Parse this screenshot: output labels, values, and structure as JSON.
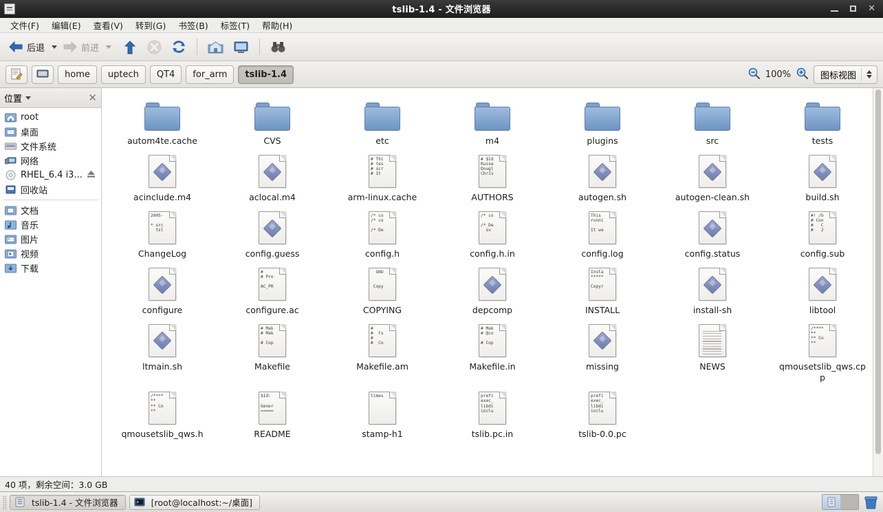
{
  "window": {
    "title": "tslib-1.4 - 文件浏览器",
    "icon": "file-manager-icon",
    "minimize_label": "最小化",
    "maximize_label": "最大化",
    "close_label": "关闭"
  },
  "menubar": [
    {
      "label": "文件(F)",
      "name": "menu-file"
    },
    {
      "label": "编辑(E)",
      "name": "menu-edit"
    },
    {
      "label": "查看(V)",
      "name": "menu-view"
    },
    {
      "label": "转到(G)",
      "name": "menu-go"
    },
    {
      "label": "书签(B)",
      "name": "menu-bookmarks"
    },
    {
      "label": "标签(T)",
      "name": "menu-tabs"
    },
    {
      "label": "帮助(H)",
      "name": "menu-help"
    }
  ],
  "toolbar": {
    "back_label": "后退",
    "forward_label": "前进",
    "up_label": "向上",
    "stop_label": "停止",
    "reload_label": "重新载入",
    "home_label": "主文件夹",
    "computer_label": "计算机",
    "search_label": "搜索"
  },
  "pathbar": {
    "edit_location_label": "编辑位置",
    "crumbs": [
      {
        "label": "",
        "icon": "computer-icon",
        "active": false
      },
      {
        "label": "home",
        "active": false
      },
      {
        "label": "uptech",
        "active": false
      },
      {
        "label": "QT4",
        "active": false
      },
      {
        "label": "for_arm",
        "active": false
      },
      {
        "label": "tslib-1.4",
        "active": true
      }
    ],
    "zoom_out_label": "缩小",
    "zoom_level": "100%",
    "zoom_in_label": "放大",
    "view_mode": "图标视图"
  },
  "sidebar": {
    "header": "位置",
    "close_label": "关闭侧边栏",
    "groups": [
      [
        {
          "label": "root",
          "icon": "home-folder-icon"
        },
        {
          "label": "桌面",
          "icon": "desktop-folder-icon"
        },
        {
          "label": "文件系统",
          "icon": "drive-icon"
        },
        {
          "label": "网络",
          "icon": "network-icon"
        },
        {
          "label": "RHEL_6.4 i3...",
          "icon": "optical-disc-icon",
          "eject": true
        },
        {
          "label": "回收站",
          "icon": "trash-icon"
        }
      ],
      [
        {
          "label": "文档",
          "icon": "documents-folder-icon"
        },
        {
          "label": "音乐",
          "icon": "music-folder-icon"
        },
        {
          "label": "图片",
          "icon": "pictures-folder-icon"
        },
        {
          "label": "视频",
          "icon": "videos-folder-icon"
        },
        {
          "label": "下载",
          "icon": "downloads-folder-icon"
        }
      ]
    ]
  },
  "files": [
    {
      "name": "autom4te.cache",
      "type": "folder"
    },
    {
      "name": "CVS",
      "type": "folder"
    },
    {
      "name": "etc",
      "type": "folder"
    },
    {
      "name": "m4",
      "type": "folder"
    },
    {
      "name": "plugins",
      "type": "folder"
    },
    {
      "name": "src",
      "type": "folder"
    },
    {
      "name": "tests",
      "type": "folder"
    },
    {
      "name": "acinclude.m4",
      "type": "script"
    },
    {
      "name": "aclocal.m4",
      "type": "script"
    },
    {
      "name": "arm-linux.cache",
      "type": "text",
      "preview": "# Thi\n# tes\n# scr\n# It"
    },
    {
      "name": "AUTHORS",
      "type": "text",
      "preview": "# $Id\nRusse\nDougl\nChris"
    },
    {
      "name": "autogen.sh",
      "type": "script"
    },
    {
      "name": "autogen-clean.sh",
      "type": "script"
    },
    {
      "name": "build.sh",
      "type": "script"
    },
    {
      "name": "ChangeLog",
      "type": "text",
      "preview": "2005-\n\n* src\n  tsl"
    },
    {
      "name": "config.guess",
      "type": "script"
    },
    {
      "name": "config.h",
      "type": "text",
      "preview": "/* co\n/* co\n\n/* De"
    },
    {
      "name": "config.h.in",
      "type": "text",
      "preview": "/* co\n\n/* De\n  sv"
    },
    {
      "name": "config.log",
      "type": "text",
      "preview": "This\nrunni\n\nIt wa"
    },
    {
      "name": "config.status",
      "type": "script"
    },
    {
      "name": "config.sub",
      "type": "text",
      "preview": "#! /b\n# Con\n#   C\n#   2"
    },
    {
      "name": "configure",
      "type": "script"
    },
    {
      "name": "configure.ac",
      "type": "text",
      "preview": "#\n# Pro\n\nAC_PR"
    },
    {
      "name": "COPYING",
      "type": "text",
      "preview": "  GNU\n\n\n Copy"
    },
    {
      "name": "depcomp",
      "type": "script"
    },
    {
      "name": "INSTALL",
      "type": "text",
      "preview": "Insta\n*****\n\nCopyr"
    },
    {
      "name": "install-sh",
      "type": "script"
    },
    {
      "name": "libtool",
      "type": "script"
    },
    {
      "name": "ltmain.sh",
      "type": "script"
    },
    {
      "name": "Makefile",
      "type": "text",
      "preview": "# Mak\n# Mak\n\n# Cop"
    },
    {
      "name": "Makefile.am",
      "type": "text",
      "preview": "#\n#  ts\n#\n#  Co"
    },
    {
      "name": "Makefile.in",
      "type": "text",
      "preview": "# Mak\n# @co\n\n# Cop"
    },
    {
      "name": "missing",
      "type": "script"
    },
    {
      "name": "NEWS",
      "type": "document"
    },
    {
      "name": "qmousetslib_qws.cpp",
      "type": "text",
      "preview": "/****\n**\n** Co\n**"
    },
    {
      "name": "qmousetslib_qws.h",
      "type": "text",
      "preview": "/****\n**\n** Co\n**"
    },
    {
      "name": "README",
      "type": "text",
      "preview": "$Id:\n\nGener\n====="
    },
    {
      "name": "stamp-h1",
      "type": "text",
      "preview": "times"
    },
    {
      "name": "tslib.pc.in",
      "type": "text",
      "preview": "prefi\nexec_\nlibdi\ninclu"
    },
    {
      "name": "tslib-0.0.pc",
      "type": "text",
      "preview": "prefi\nexec_\nlibdi\ninclu"
    }
  ],
  "statusbar": {
    "text": "40 项，剩余空间：3.0 GB"
  },
  "taskbar": {
    "tasks": [
      {
        "label": "tslib-1.4 - 文件浏览器",
        "icon": "file-manager-icon",
        "active": true
      },
      {
        "label": "[root@localhost:~/桌面]",
        "icon": "terminal-icon",
        "active": false
      }
    ],
    "workspaces": 2,
    "active_workspace": 1,
    "trash_label": "回收站"
  },
  "colors": {
    "titlebar": "#2b2b2b",
    "chrome": "#ededeb",
    "folder": "#87a9d2",
    "accent": "#6f7cae",
    "content_bg": "#ffffff"
  }
}
